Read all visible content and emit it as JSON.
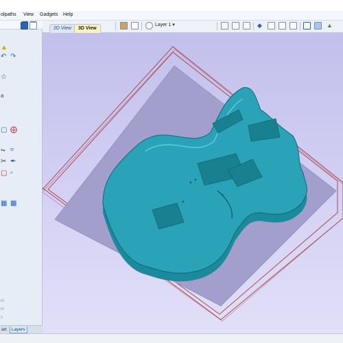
{
  "menu": {
    "items": [
      "olpaths",
      "View",
      "Gadgets",
      "Help"
    ]
  },
  "view_tabs": {
    "tab_2d": "2D View",
    "tab_3d": "3D View"
  },
  "toolbar": {
    "layer_label": "Layer 1 ▾"
  },
  "side_panel": {
    "meta_lines": [
      "m",
      "m",
      "s"
    ]
  },
  "bottom_tabs": {
    "partial": "art",
    "layers": "Layers"
  },
  "colors": {
    "viewport_top": "#c2c0ec",
    "part_fill": "#2aa3b8",
    "part_edge": "#0f6878",
    "boundary_line": "#a8494d",
    "active_tab": "#fbf3c4"
  }
}
